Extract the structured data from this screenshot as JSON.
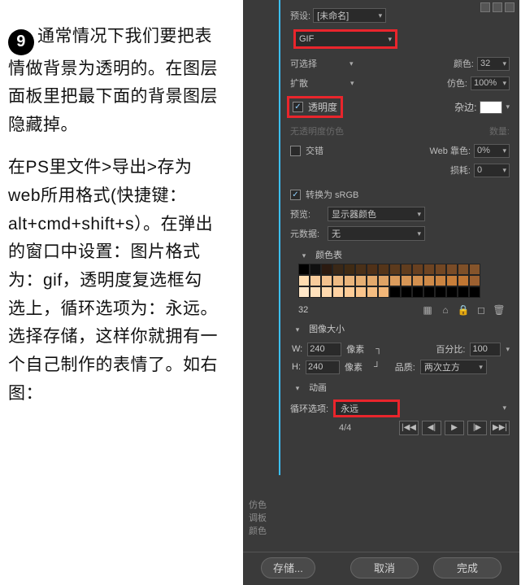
{
  "step_number": "9",
  "para1": "通常情况下我们要把表情做背景为透明的。在图层面板里把最下面的背景图层隐藏掉。",
  "para2": "在PS里文件>导出>存为web所用格式(快捷键：alt+cmd+shift+s）。在弹出的窗口中设置：图片格式为：gif，透明度复选框勾选上，循环选项为：永远。选择存储，这样你就拥有一个自己制作的表情了。如右图：",
  "panel": {
    "preset_label": "预设:",
    "preset_value": "[未命名]",
    "format_value": "GIF",
    "selectable_label": "可选择",
    "diffusion_label": "扩散",
    "transparency_label": "透明度",
    "no_trans_dither_label": "无透明度仿色",
    "interlaced_label": "交错",
    "color_label": "颜色:",
    "color_value": "32",
    "dither_label": "仿色:",
    "dither_value": "100%",
    "matte_label": "杂边:",
    "amount_label": "数量:",
    "web_snap_label": "Web 靠色:",
    "web_snap_value": "0%",
    "lossy_label": "损耗:",
    "lossy_value": "0",
    "convert_srgb_label": "转换为 sRGB",
    "preview_label": "预览:",
    "preview_value": "显示器颜色",
    "metadata_label": "元数据:",
    "metadata_value": "无",
    "color_table_label": "颜色表",
    "color_count": "32",
    "image_size_label": "图像大小",
    "width_label": "W:",
    "width_value": "240",
    "height_label": "H:",
    "height_value": "240",
    "pixel_label": "像素",
    "percent_label": "百分比:",
    "percent_value": "100",
    "quality_label": "品质:",
    "quality_value": "两次立方",
    "animation_label": "动画",
    "loop_label": "循环选项:",
    "loop_value": "永远",
    "frame_indicator": "4/4",
    "side_tab1": "仿色",
    "side_tab2": "调板",
    "side_tab3": "颜色",
    "btn_save": "存储...",
    "btn_cancel": "取消",
    "btn_done": "完成"
  },
  "swatches": [
    [
      "#000000",
      "#101010",
      "#2b1a10",
      "#3a2817",
      "#402b14",
      "#4a3018",
      "#503118",
      "#553519",
      "#5c3a1c",
      "#613d1e",
      "#684020",
      "#6e4422",
      "#734723",
      "#7a4c27",
      "#7f5028",
      "#85542b"
    ],
    [
      "#ffdcb0",
      "#f7cc9c",
      "#f2c18e",
      "#eebb84",
      "#eab57c",
      "#e6af73",
      "#e3a96c",
      "#dfa365",
      "#db9c5d",
      "#d79656",
      "#d3904f",
      "#cf8a48",
      "#cb8441",
      "#c77e3a",
      "#c07633",
      "#9c6030"
    ],
    [
      "#ffe7c8",
      "#ffe1bc",
      "#ffd9ae",
      "#ffd2a2",
      "#ffcc97",
      "#fbc58c",
      "#f6be82",
      "#f2b779",
      "#000000",
      "#000000",
      "#000000",
      "#000000",
      "#000000",
      "#000000",
      "#000000",
      "#000000"
    ]
  ]
}
